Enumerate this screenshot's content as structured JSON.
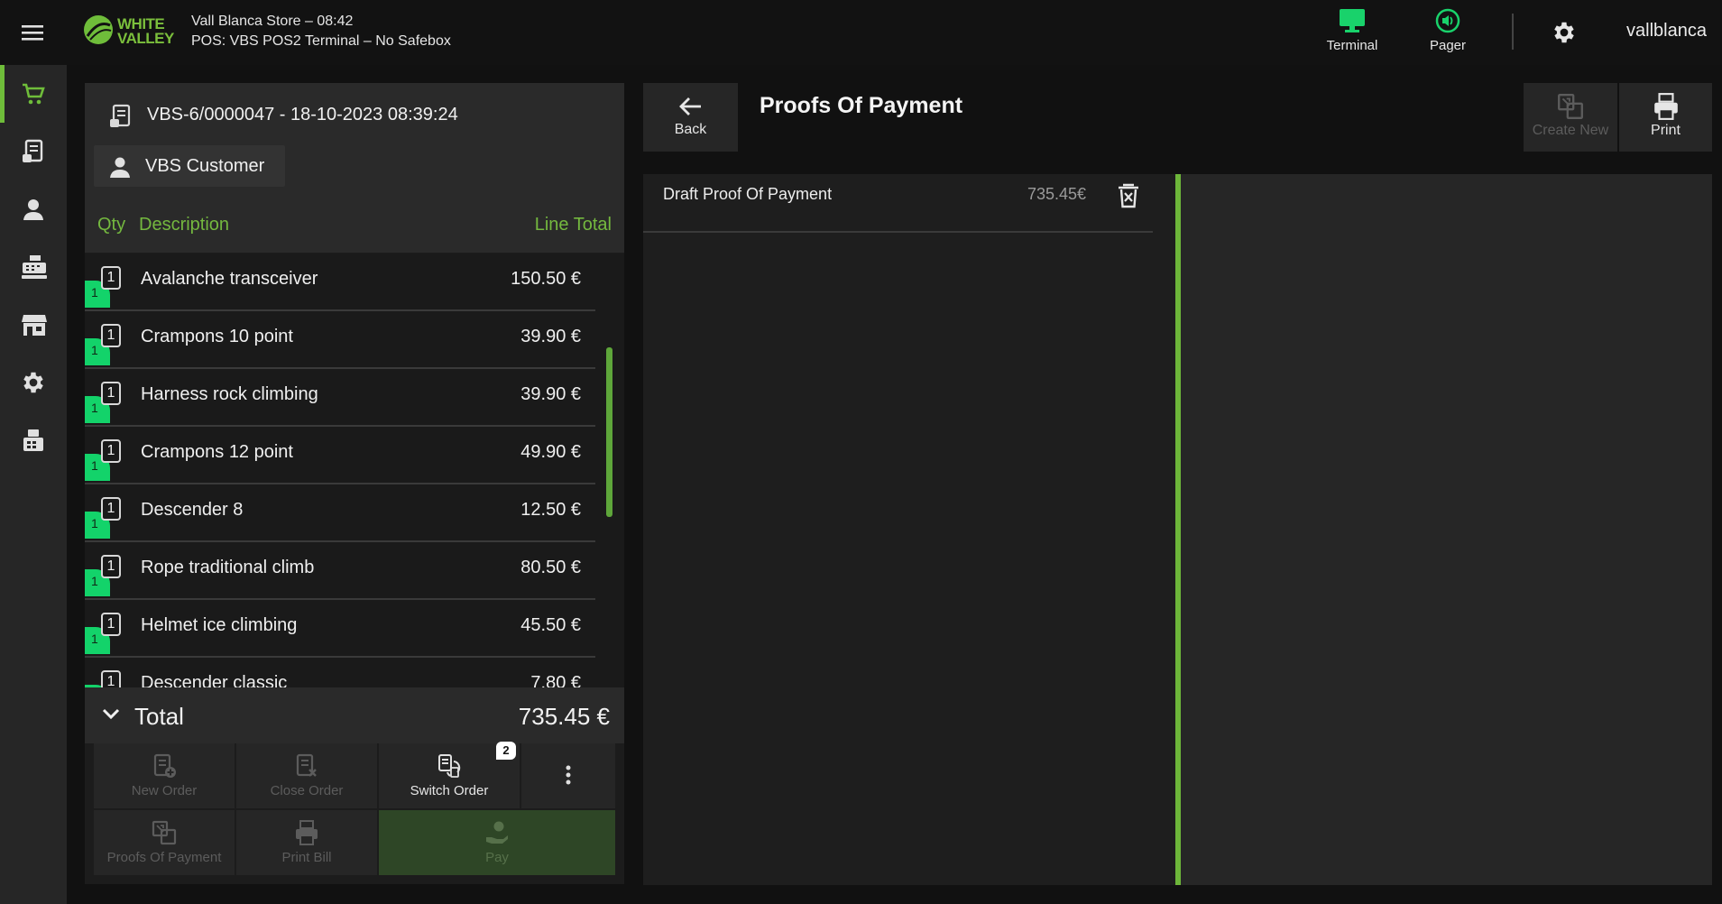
{
  "header": {
    "logo_text_1": "WHITE",
    "logo_text_2": "VALLEY",
    "store_line": "Vall Blanca Store – 08:42",
    "terminal_line": "POS: VBS POS2 Terminal – No Safebox",
    "terminal_label": "Terminal",
    "pager_label": "Pager",
    "username": "vallblanca"
  },
  "order": {
    "id": "VBS-6/0000047 - 18-10-2023 08:39:24",
    "customer": "VBS Customer",
    "columns": {
      "qty": "Qty",
      "description": "Description",
      "line_total": "Line Total"
    },
    "lines": [
      {
        "qty": "1",
        "flag": "1",
        "description": "Avalanche transceiver",
        "total": "150.50 €"
      },
      {
        "qty": "1",
        "flag": "1",
        "description": "Crampons 10 point",
        "total": "39.90 €"
      },
      {
        "qty": "1",
        "flag": "1",
        "description": "Harness rock climbing",
        "total": "39.90 €"
      },
      {
        "qty": "1",
        "flag": "1",
        "description": "Crampons 12 point",
        "total": "49.90 €"
      },
      {
        "qty": "1",
        "flag": "1",
        "description": "Descender 8",
        "total": "12.50 €"
      },
      {
        "qty": "1",
        "flag": "1",
        "description": "Rope traditional climb",
        "total": "80.50 €"
      },
      {
        "qty": "1",
        "flag": "1",
        "description": "Helmet ice climbing",
        "total": "45.50 €"
      },
      {
        "qty": "1",
        "flag": "1",
        "description": "Descender classic",
        "total": "7.80 €"
      }
    ],
    "total_label": "Total",
    "total_value": "735.45 €"
  },
  "actions": {
    "new_order": "New Order",
    "close_order": "Close Order",
    "switch_order": "Switch Order",
    "switch_badge": "2",
    "proofs_of_payment": "Proofs Of Payment",
    "print_bill": "Print Bill",
    "pay": "Pay"
  },
  "proofs": {
    "back": "Back",
    "title": "Proofs Of Payment",
    "create_new": "Create New",
    "print": "Print",
    "items": [
      {
        "name": "Draft Proof Of Payment",
        "amount": "735.45€"
      }
    ]
  },
  "colors": {
    "accent_green": "#6fbd3a",
    "flag_green": "#13d36a",
    "icon_green": "#19d26b"
  }
}
